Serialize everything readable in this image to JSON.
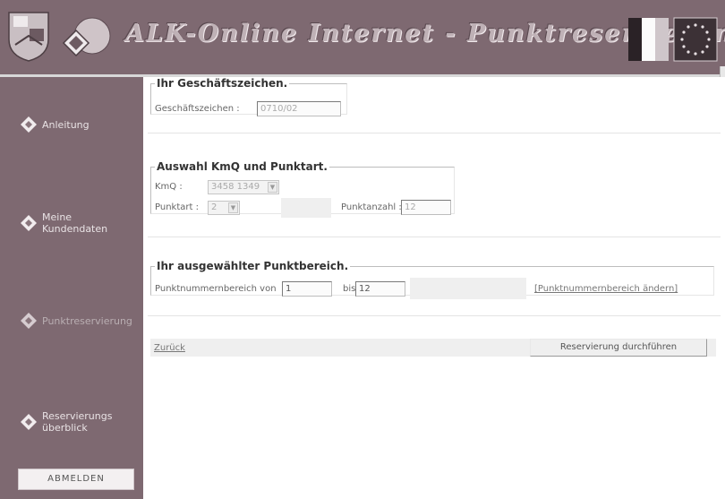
{
  "header": {
    "title": "ALK-Online Internet - Punktreservierung"
  },
  "sidebar": {
    "items": [
      {
        "label": "Anleitung"
      },
      {
        "label": "Meine Kundendaten"
      },
      {
        "label": "Punktreservierung"
      },
      {
        "label": "Reservierungs überblick"
      }
    ],
    "logout_label": "ABMELDEN"
  },
  "section_reference": {
    "legend": "Ihr Geschäftszeichen.",
    "field_label": "Geschäftszeichen :",
    "field_value": "0710/02"
  },
  "section_selection": {
    "legend": "Auswahl KmQ und Punktart.",
    "kmq_label": "KmQ :",
    "kmq_value": "3458 1349",
    "punktart_label": "Punktart :",
    "punktart_value": "2",
    "punktanzahl_label": "Punktanzahl :",
    "punktanzahl_value": "12"
  },
  "section_range": {
    "legend": "Ihr ausgewählter Punktbereich.",
    "range_from_label": "Punktnummernbereich von",
    "range_from_value": "1",
    "range_to_label": "bis",
    "range_to_value": "12",
    "change_link": "[Punktnummernbereich ändern]"
  },
  "actions": {
    "back_label": "Zurück",
    "submit_label": "Reservierung durchführen"
  },
  "colors": {
    "sidebar_bg": "#7e6971",
    "main_bg": "#ffffff"
  }
}
